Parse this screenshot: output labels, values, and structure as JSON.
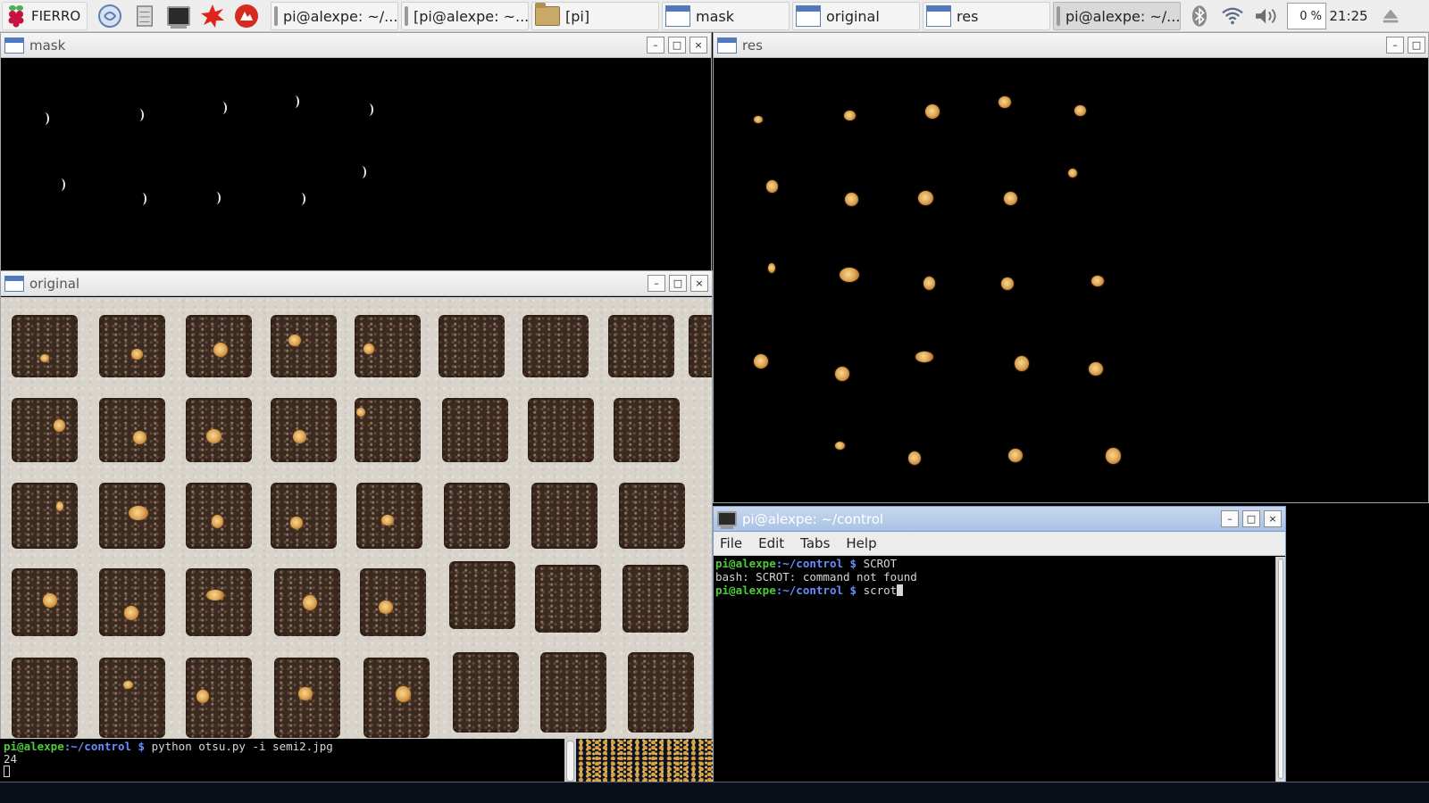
{
  "taskbar": {
    "menu_label": "FIERRO",
    "launchers": [
      "web-browser-icon",
      "file-manager-icon",
      "terminal-icon",
      "wolfram-icon",
      "mathematica-icon"
    ],
    "tasks": [
      {
        "label": "pi@alexpe: ~/...",
        "icon": "terminal-icon",
        "active": false
      },
      {
        "label": "[pi@alexpe: ~...",
        "icon": "terminal-icon",
        "active": false
      },
      {
        "label": "[pi]",
        "icon": "folder-icon",
        "active": false
      },
      {
        "label": "mask",
        "icon": "window-icon",
        "active": false
      },
      {
        "label": "original",
        "icon": "window-icon",
        "active": false
      },
      {
        "label": "res",
        "icon": "window-icon",
        "active": false
      },
      {
        "label": "pi@alexpe: ~/...",
        "icon": "terminal-icon",
        "active": true
      }
    ],
    "cpu_usage": "0 %",
    "clock": "21:25"
  },
  "windows": {
    "mask": {
      "title": "mask"
    },
    "res": {
      "title": "res"
    },
    "original": {
      "title": "original"
    },
    "terminal": {
      "title": "pi@alexpe: ~/control",
      "menu": [
        "File",
        "Edit",
        "Tabs",
        "Help"
      ],
      "lines": [
        {
          "user": "pi@alexpe",
          "path": ":~/control",
          "symbol": " $ ",
          "cmd": "SCROT"
        },
        {
          "text": "bash: SCROT: command not found"
        },
        {
          "user": "pi@alexpe",
          "path": ":~/control",
          "symbol": " $ ",
          "cmd": "scrot"
        }
      ]
    }
  },
  "background_terminal": {
    "user": "pi@alexpe",
    "path": ":~/control",
    "symbol": " $ ",
    "cmd": "python otsu.py -i semi2.jpg",
    "output": "24"
  },
  "window_buttons": {
    "minimize": "–",
    "maximize": "□",
    "close": "×"
  },
  "colors": {
    "prompt_user": "#4ecb3c",
    "prompt_path": "#6b8cff",
    "active_title": "#a9c2e4"
  }
}
